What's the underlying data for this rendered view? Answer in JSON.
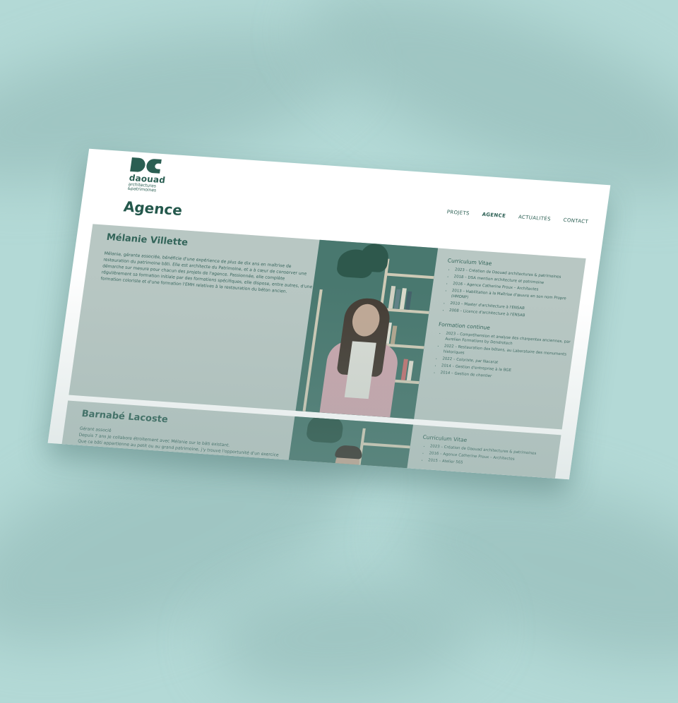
{
  "site": {
    "logo_name": "daouad",
    "logo_sub1": "architectures",
    "logo_sub2": "&patrimoines"
  },
  "nav": [
    "PROJETS",
    "AGENCE",
    "ACTUALITÉS",
    "CONTACT"
  ],
  "page_title": "Agence",
  "people": [
    {
      "name": "Mélanie Villette",
      "bio": "Mélanie, gérante associée, bénéficie d'une expérience de plus de dix ans en maîtrise de restauration du patrimoine bâti. Elle est architecte du Patrimoine, et a à cœur de conserver une démarche sur mesure pour chacun des projets de l'agence. Passionnée, elle complète régulièrement sa formation initiale par des formations spécifiques, elle dispose, entre autres, d'une formation coloriste et d'une formation l'EMH relatives à la restauration du béton ancien.",
      "cv_title": "Curriculum Vitae",
      "cv": [
        "2023 – Création de Daouad architectures & patrimoines",
        "2018 – DSA mention architecture et patrimoine",
        "2016 – Agence Catherine Proux – Architectes",
        "2013 – Habilitation à la Maîtrise d'œuvre en son nom Propre (HMONP)",
        "2010 – Master d'architecture à l'ENSAB",
        "2008 – Licence d'architecture à l'ENSAB"
      ],
      "formation_title": "Formation continue",
      "formation": [
        "2023 – Compréhension et analyse des charpentes anciennes, par Aurelien Formations by Dendrotech",
        "2022 – Restauration des bétons, au Laboratoire des monuments historiques",
        "2022 – Coloriste, par Nacarat",
        "2014 – Gestion d'entreprise à la BGE",
        "2014 – Gestion de chantier"
      ]
    },
    {
      "name": "Barnabé Lacoste",
      "bio1": "Gérant associé",
      "bio2": "Depuis 7 ans je collabore étroitement avec Mélanie sur le bâti existant.",
      "bio3": "Que ce bâti appartienne au petit ou au grand patrimoine, j'y trouve l'opportunité d'un exercice",
      "cv_title": "Curriculum Vitae",
      "cv": [
        "2023 – Création de Daouad architectures & patrimoines",
        "2016 – Agence Catherine Proux – Architectes",
        "2015 – Atelier 565"
      ]
    }
  ]
}
